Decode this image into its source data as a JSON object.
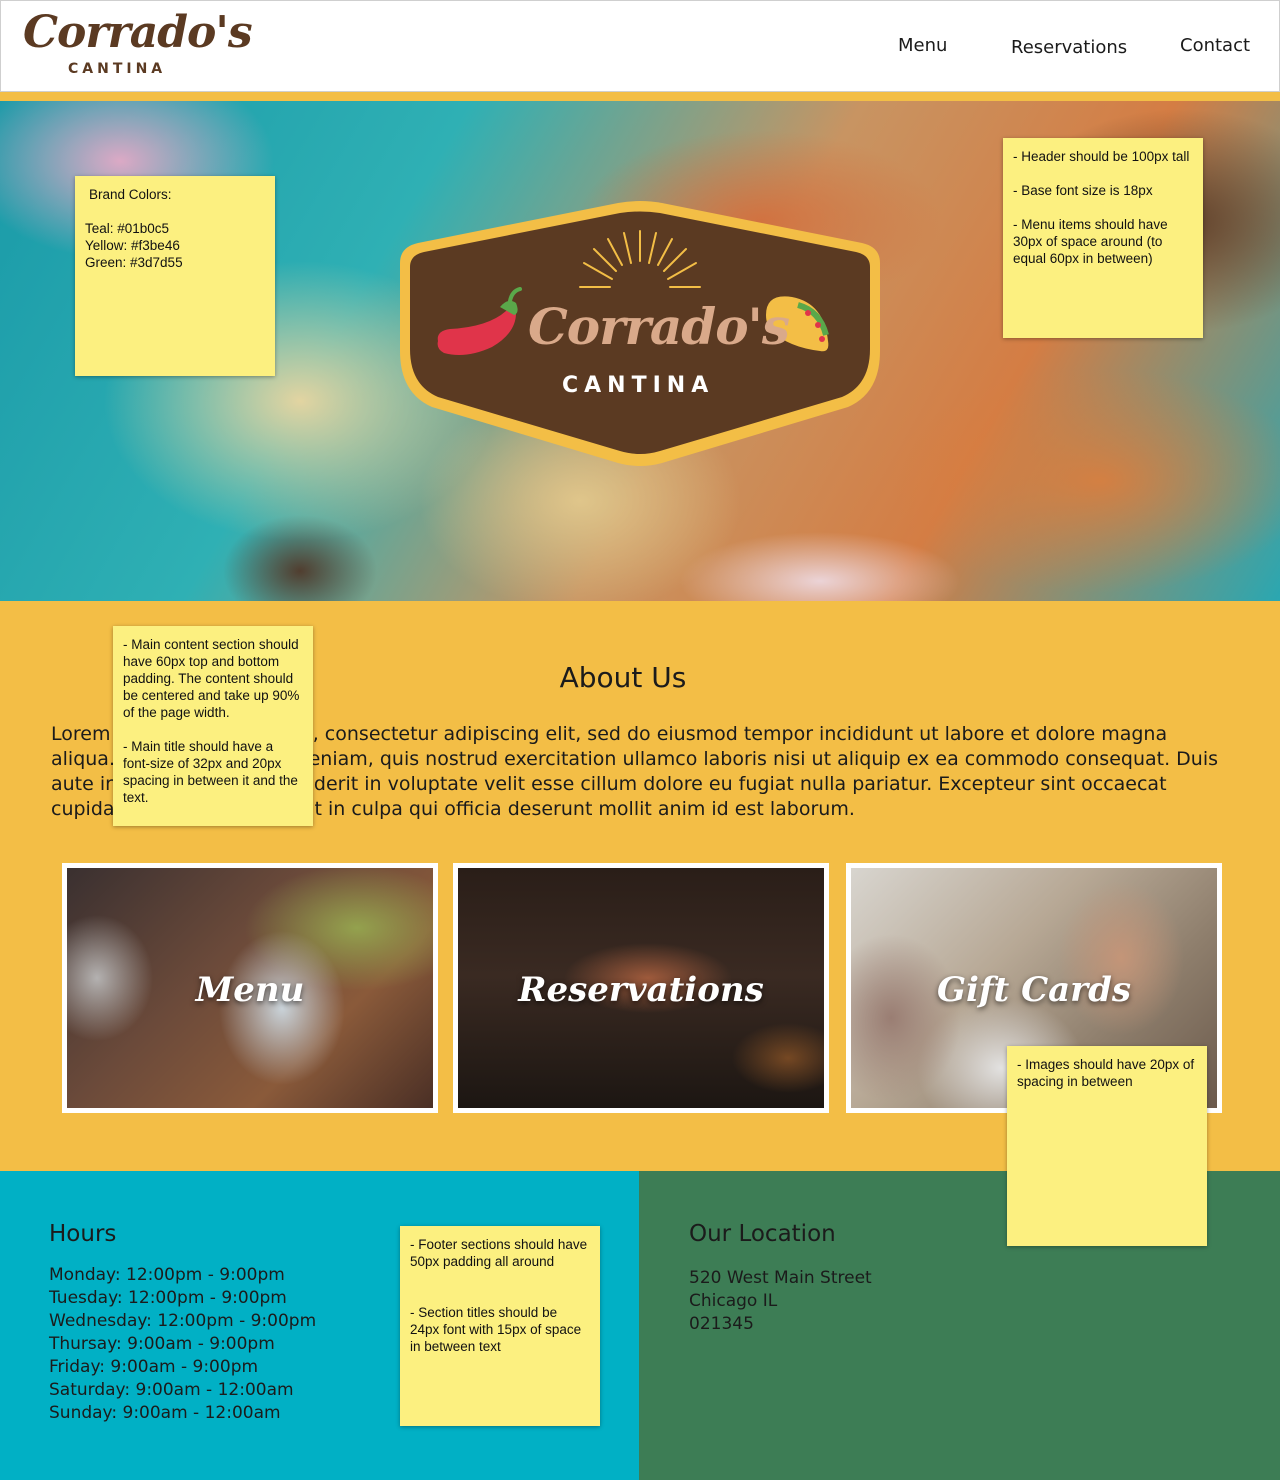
{
  "brand": {
    "logo_script": "Corrado's",
    "logo_sub": "CANTINA"
  },
  "nav": {
    "menu": "Menu",
    "reservations": "Reservations",
    "contact": "Contact"
  },
  "hero": {
    "badge_script": "Corrado's",
    "badge_sub": "CANTINA",
    "icons": [
      "chili-pepper-icon",
      "taco-icon",
      "sun-rays-icon"
    ]
  },
  "colors": {
    "teal": "#01b0c5",
    "yellow": "#f3be46",
    "green": "#3d7d55",
    "brown": "#5b3a22"
  },
  "about": {
    "title": "About Us",
    "text": "Lorem ipsum dolor sit amet, consectetur adipiscing elit, sed do eiusmod tempor incididunt ut labore et dolore magna aliqua. Ut enim ad minim veniam, quis nostrud exercitation ullamco laboris nisi ut aliquip ex ea commodo consequat. Duis aute irure dolor in reprehenderit in voluptate velit esse cillum dolore eu fugiat nulla pariatur. Excepteur sint occaecat cupidatat non proident, sunt in culpa qui officia deserunt mollit anim id est laborum."
  },
  "cards": [
    {
      "label": "Menu"
    },
    {
      "label": "Reservations"
    },
    {
      "label": "Gift Cards"
    }
  ],
  "footer": {
    "hours_title": "Hours",
    "hours": [
      "Monday: 12:00pm - 9:00pm",
      "Tuesday: 12:00pm - 9:00pm",
      "Wednesday: 12:00pm - 9:00pm",
      "Thursay: 9:00am - 9:00pm",
      "Friday: 9:00am - 9:00pm",
      "Saturday: 9:00am - 12:00am",
      "Sunday: 9:00am - 12:00am"
    ],
    "location_title": "Our Location",
    "location": [
      "520 West Main Street",
      "Chicago IL",
      "021345"
    ]
  },
  "notes": {
    "brand_colors": [
      "Brand Colors:",
      "",
      "Teal: #01b0c5",
      "Yellow: #f3be46",
      "Green: #3d7d55"
    ],
    "header": [
      "- Header should be 100px tall",
      "",
      "- Base font size is 18px",
      "",
      "- Menu items should have 30px of space around (to equal 60px in between)"
    ],
    "main": [
      "- Main content section should have 60px top and bottom padding. The content should be centered and take up 90% of the page width.",
      "",
      "- Main title should have a font-size of 32px and 20px spacing in between it and the text."
    ],
    "images": [
      "- Images should have 20px of spacing in between"
    ],
    "footer": [
      "- Footer sections should have 50px padding all around",
      "",
      "",
      "- Section titles should be 24px font with 15px of space in between text"
    ]
  }
}
